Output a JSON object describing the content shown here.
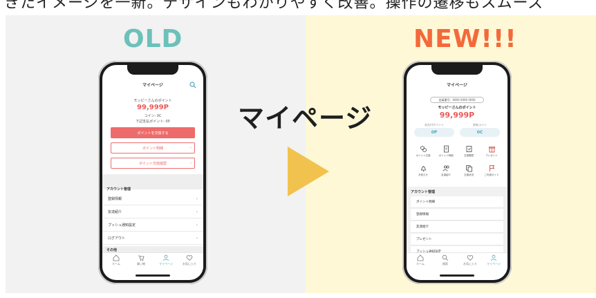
{
  "caption": "きたイメージを一新。デザインもわかりやすく改善。操作の遷移もスムーズ",
  "labels": {
    "old": "OLD",
    "new": "NEW!!!"
  },
  "center_title": "マイページ",
  "colors": {
    "old_label": "#6cc1b9",
    "new_label": "#f4693a",
    "arrow": "#f1c24e",
    "accent_red": "#ee6b6b",
    "accent_teal": "#4aa7b8"
  },
  "old_screen": {
    "header": "マイページ",
    "points_name": "モッピーさんのポイント",
    "points_value": "99,999P",
    "coin_line": "コイン: 0C",
    "unused_line": "下記支払ポイント: 0P",
    "btn_exchange": "ポイントを交換する",
    "btn_detail": "ポイント明細",
    "btn_history": "ポイント交換履歴",
    "section_account": "アカウント管理",
    "menu": [
      "登録情報",
      "友達紹介",
      "プッシュ通知設定",
      "ログアウト"
    ],
    "section_other": "その他",
    "tabs": [
      "ホーム",
      "買い物",
      "マイページ",
      "お気に入り"
    ]
  },
  "new_screen": {
    "header": "マイページ",
    "member_no": "会員番号：0000 0000 0000",
    "points_name": "モッピーさんのポイント",
    "points_value": "99,999P",
    "stat1_label": "未交付ポイント",
    "stat1_value": "0P",
    "stat2_label": "保有コイン",
    "stat2_value": "0C",
    "grid": [
      "ポイント交換",
      "ポイント明細",
      "交換履歴",
      "プレゼント",
      "お知らせ",
      "友達紹介",
      "交換状況",
      "ご利用ガイド"
    ],
    "section_account": "アカウント管理",
    "menu": [
      "ポイント明細",
      "登録情報",
      "友達紹介",
      "プレゼント",
      "プッシュ通知設定"
    ],
    "tabs": [
      "ホーム",
      "検索",
      "お気に入り",
      "マイページ"
    ]
  }
}
